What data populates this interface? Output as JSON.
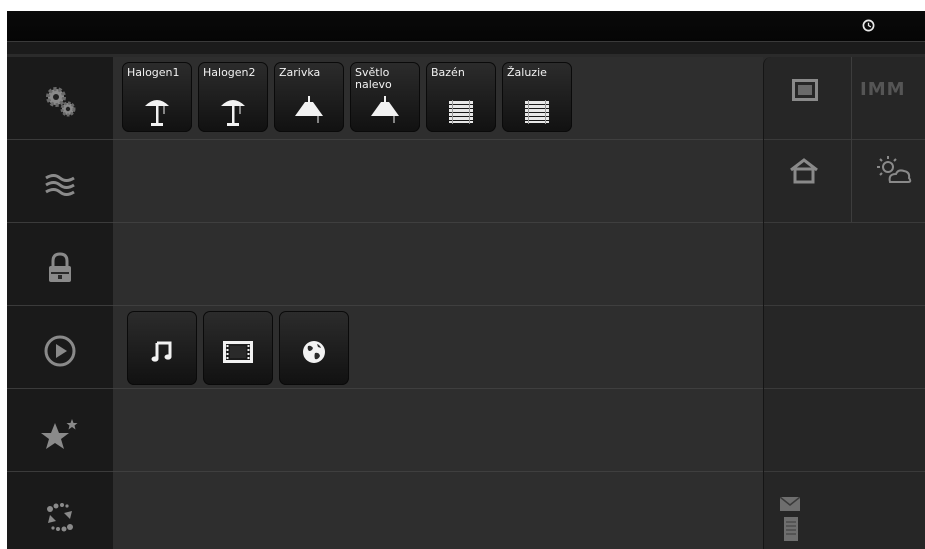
{
  "statusbar": {
    "icons": [
      "clock-icon"
    ]
  },
  "sidebar": {
    "items": [
      {
        "name": "settings",
        "icon": "gears-icon"
      },
      {
        "name": "heating",
        "icon": "waves-icon"
      },
      {
        "name": "security",
        "icon": "lock-icon"
      },
      {
        "name": "media",
        "icon": "play-icon"
      },
      {
        "name": "favorites",
        "icon": "stars-icon"
      },
      {
        "name": "scenes",
        "icon": "dots-icon"
      }
    ]
  },
  "devices": {
    "lights": [
      {
        "label": "Halogen1",
        "icon": "floor-lamp-icon"
      },
      {
        "label": "Halogen2",
        "icon": "floor-lamp-icon"
      },
      {
        "label": "Zarivka",
        "icon": "ceiling-lamp-icon"
      },
      {
        "label": "Světlo nalevo",
        "icon": "ceiling-lamp-icon"
      },
      {
        "label": "Bazén",
        "icon": "blinds-icon"
      },
      {
        "label": "Žaluzie",
        "icon": "blinds-icon"
      }
    ],
    "media": [
      {
        "icon": "music-icon"
      },
      {
        "icon": "film-icon"
      },
      {
        "icon": "globe-icon"
      }
    ]
  },
  "rightpanel": {
    "brand": "IMM",
    "icons": [
      "window-icon",
      "house-icon",
      "weather-icon",
      "mail-icon",
      "document-icon"
    ]
  },
  "colors": {
    "background": "#2b2b2b",
    "tile": "#1a1a1a",
    "text": "#f2f2f2"
  }
}
